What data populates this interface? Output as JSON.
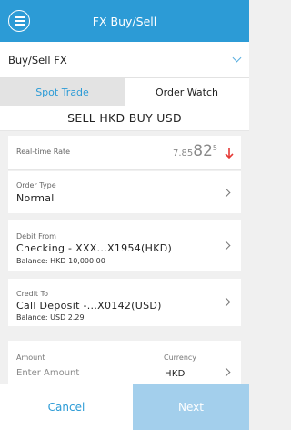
{
  "header": {
    "title": "FX Buy/Sell",
    "menu_icon": "menu-icon"
  },
  "selector": {
    "label": "Buy/Sell FX",
    "icon": "chevron-down-icon"
  },
  "tabs": [
    {
      "label": "Spot Trade",
      "active": true
    },
    {
      "label": "Order Watch",
      "active": false
    }
  ],
  "direction": "SELL HKD BUY USD",
  "rate": {
    "label": "Real-time Rate",
    "prefix": "7.85",
    "big": "82",
    "sup": "5",
    "trend_icon": "arrow-down-icon",
    "trend_color": "#e53935"
  },
  "order_type": {
    "label": "Order Type",
    "value": "Normal"
  },
  "debit": {
    "label": "Debit From",
    "account": "Checking - XXX...X1954(HKD)",
    "balance": "Balance: HKD 10,000.00"
  },
  "credit": {
    "label": "Credit To",
    "account": "Call Deposit -...X0142(USD)",
    "balance": "Balance: USD 2.29"
  },
  "amount": {
    "label": "Amount",
    "placeholder": "Enter Amount",
    "currency_label": "Currency",
    "currency": "HKD"
  },
  "buttons": {
    "cancel": "Cancel",
    "next": "Next"
  },
  "colors": {
    "primary": "#2c9bd6",
    "next_disabled": "#a3cfec",
    "background": "#f0f0f0"
  }
}
